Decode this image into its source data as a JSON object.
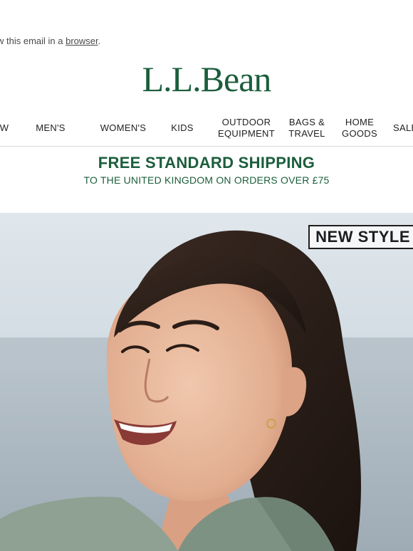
{
  "preheader": {
    "text": "w this email in a ",
    "link": "browser",
    "suffix": "."
  },
  "brand": {
    "logo": "L.L.Bean",
    "color": "#1b5e3b"
  },
  "nav": {
    "items": [
      {
        "label": "W"
      },
      {
        "label": "MEN'S"
      },
      {
        "label": "WOMEN'S"
      },
      {
        "label": "KIDS"
      },
      {
        "label": "OUTDOOR EQUIPMENT",
        "line1": "OUTDOOR",
        "line2": "EQUIPMENT"
      },
      {
        "label": "BAGS & TRAVEL",
        "line1": "BAGS &",
        "line2": "TRAVEL"
      },
      {
        "label": "HOME GOODS",
        "line1": "HOME",
        "line2": "GOODS"
      },
      {
        "label": "SALE"
      }
    ]
  },
  "shipping": {
    "headline": "FREE STANDARD SHIPPING",
    "subline": "TO THE UNITED KINGDOM ON ORDERS OVER £75"
  },
  "hero": {
    "badge": "NEW STYLE"
  }
}
